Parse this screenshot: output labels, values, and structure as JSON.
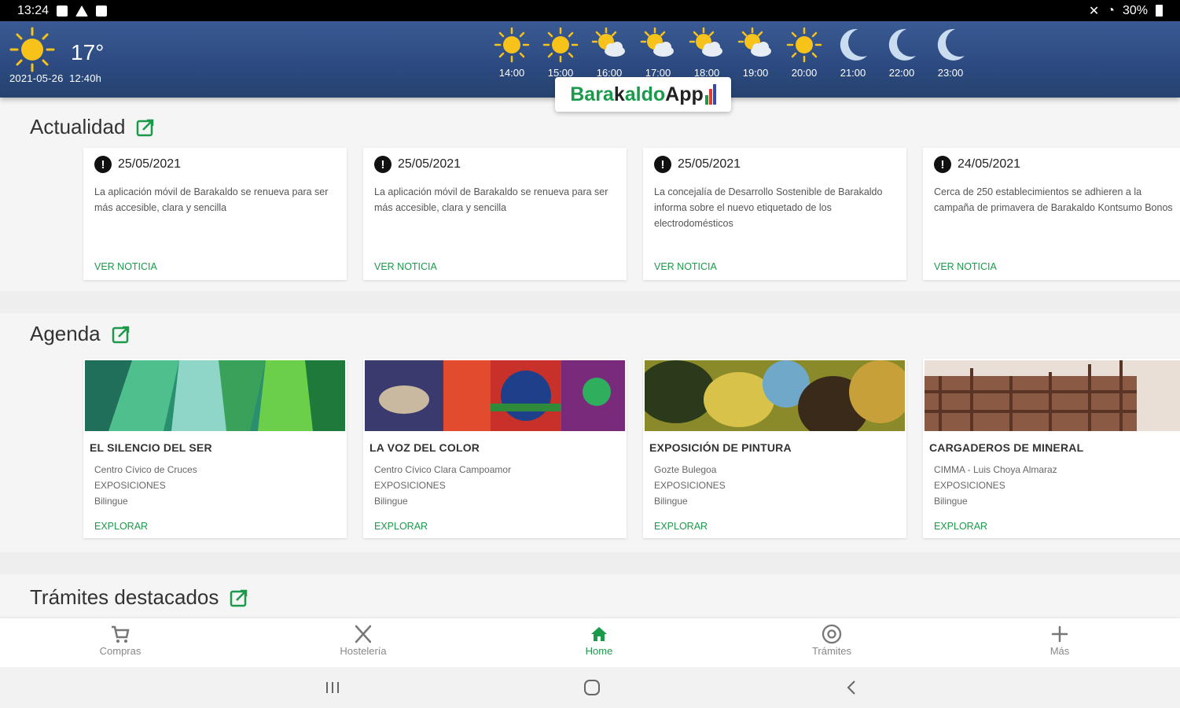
{
  "status": {
    "time": "13:24",
    "battery": "30%"
  },
  "weather": {
    "current_temp": "17°",
    "current_date": "2021-05-26",
    "current_time": "12:40h",
    "forecast": [
      {
        "time": "14:00",
        "icon": "sun-icon"
      },
      {
        "time": "15:00",
        "icon": "sun-icon"
      },
      {
        "time": "16:00",
        "icon": "sun-cloud-icon"
      },
      {
        "time": "17:00",
        "icon": "sun-cloud-icon"
      },
      {
        "time": "18:00",
        "icon": "sun-cloud-icon"
      },
      {
        "time": "19:00",
        "icon": "sun-cloud-icon"
      },
      {
        "time": "20:00",
        "icon": "sun-icon"
      },
      {
        "time": "21:00",
        "icon": "moon-icon"
      },
      {
        "time": "22:00",
        "icon": "moon-icon"
      },
      {
        "time": "23:00",
        "icon": "moon-icon"
      }
    ]
  },
  "logo": {
    "part1": "Bara",
    "part2": "k",
    "part3": "aldo",
    "part4": "App"
  },
  "actualidad": {
    "title": "Actualidad",
    "items": [
      {
        "date": "25/05/2021",
        "text": "La aplicación móvil de Barakaldo se renueva para ser más accesible, clara y sencilla",
        "link": "VER NOTICIA"
      },
      {
        "date": "25/05/2021",
        "text": "La aplicación móvil de Barakaldo se renueva para ser más accesible, clara y sencilla",
        "link": "VER NOTICIA"
      },
      {
        "date": "25/05/2021",
        "text": "La concejalía de Desarrollo Sostenible de Barakaldo informa sobre el nuevo etiquetado de los electrodomésticos",
        "link": "VER NOTICIA"
      },
      {
        "date": "24/05/2021",
        "text": "Cerca de 250 establecimientos se adhieren a la campaña de primavera de Barakaldo Kontsumo Bonos",
        "link": "VER NOTICIA"
      }
    ]
  },
  "agenda": {
    "title": "Agenda",
    "items": [
      {
        "title": "EL SILENCIO DEL SER",
        "place": "Centro Cívico de Cruces",
        "category": "EXPOSICIONES",
        "language": "Bilingue",
        "link": "EXPLORAR"
      },
      {
        "title": "LA VOZ DEL COLOR",
        "place": "Centro Cívico Clara Campoamor",
        "category": "EXPOSICIONES",
        "language": "Bilingue",
        "link": "EXPLORAR"
      },
      {
        "title": "EXPOSICIÓN DE PINTURA",
        "place": "Gozte Bulegoa",
        "category": "EXPOSICIONES",
        "language": "Bilingue",
        "link": "EXPLORAR"
      },
      {
        "title": "CARGADEROS DE MINERAL",
        "place": "CIMMA - Luis Choya Almaraz",
        "category": "EXPOSICIONES",
        "language": "Bilingue",
        "link": "EXPLORAR"
      }
    ]
  },
  "tramites": {
    "title": "Trámites destacados"
  },
  "nav": {
    "items": [
      {
        "label": "Compras",
        "icon": "cart-icon"
      },
      {
        "label": "Hostelería",
        "icon": "utensils-icon"
      },
      {
        "label": "Home",
        "icon": "home-icon",
        "active": true
      },
      {
        "label": "Trámites",
        "icon": "at-icon"
      },
      {
        "label": "Más",
        "icon": "plus-icon"
      }
    ]
  },
  "colors": {
    "accent": "#1a9a4a",
    "header": "#2c4a80"
  }
}
